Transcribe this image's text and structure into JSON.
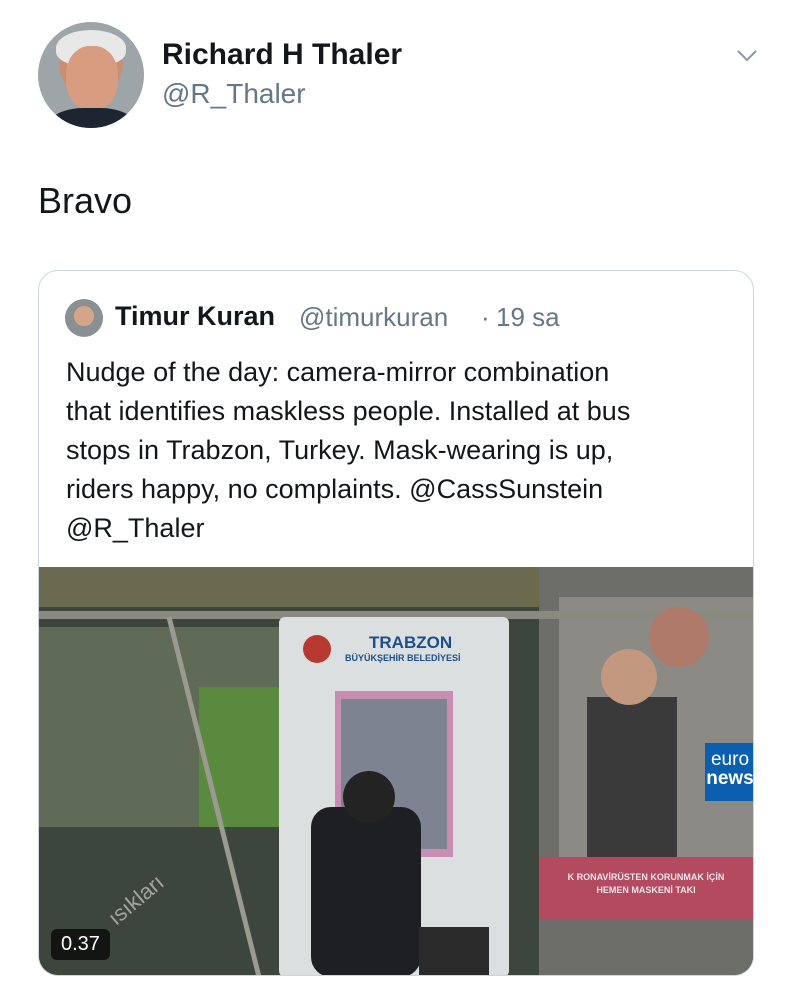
{
  "tweet": {
    "author_name": "Richard H Thaler",
    "author_handle": "@R_Thaler",
    "text": "Bravo",
    "menu_icon": "chevron-down-icon"
  },
  "quoted_tweet": {
    "author_name": "Timur Kuran",
    "author_handle": "@timurkuran",
    "separator": "·",
    "time": "19 sa",
    "text_lines": [
      "Nudge of the day: camera-mirror combination",
      "that identifies maskless people. Installed at bus",
      "stops in Trabzon, Turkey. Mask-wearing is up,",
      "riders happy, no complaints. @CassSunstein",
      "@R_Thaler"
    ],
    "media": {
      "duration": "0.37",
      "sign_title": "TRABZON",
      "sign_subtitle": "BÜYÜKŞEHİR BELEDİYESİ",
      "channel_logo_line1": "euro",
      "channel_logo_line2": "news",
      "caption_line1": "K RONAVİRÜSTEN KORUNMAK İÇİN",
      "caption_line2": "HEMEN MASKENİ TAKI",
      "watermark": "ısıkları"
    }
  },
  "colors": {
    "primary_text": "#14171a",
    "secondary_text": "#657786",
    "border": "#ccd6dd",
    "euronews_blue": "#0b5fb0",
    "caption_red": "#b34a5f"
  }
}
